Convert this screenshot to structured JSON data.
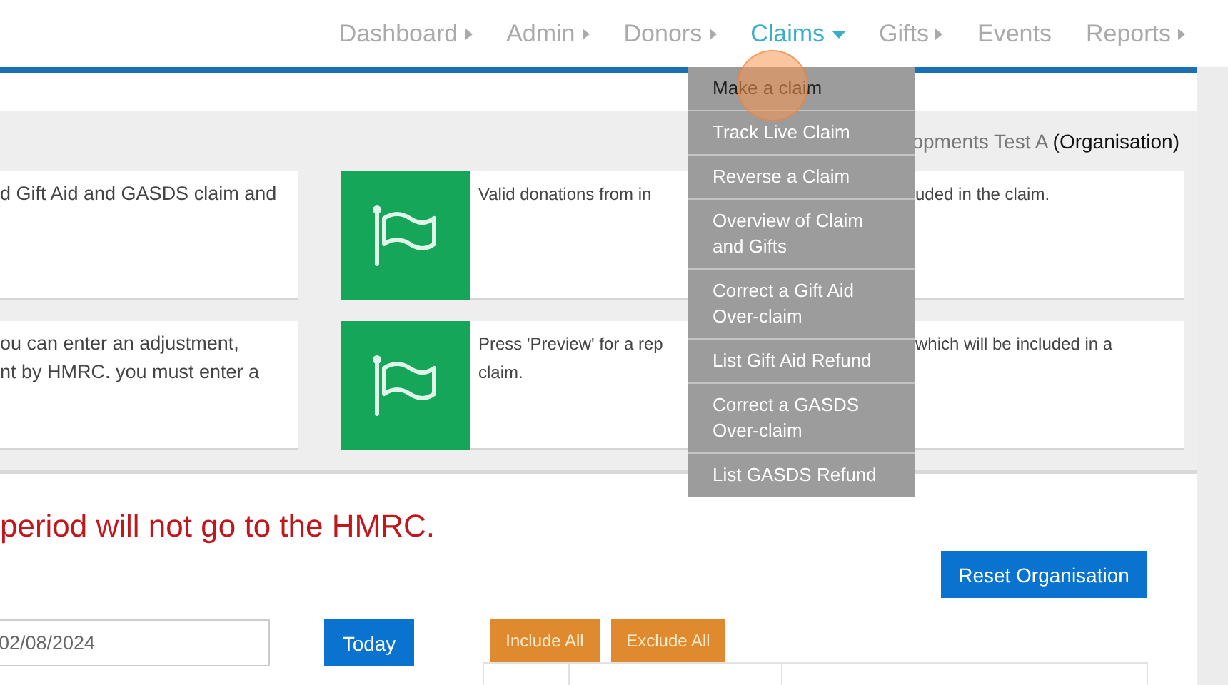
{
  "nav": {
    "items": [
      {
        "label": "Dashboard",
        "kind": "submenu",
        "selected": false
      },
      {
        "label": "Admin",
        "kind": "submenu",
        "selected": false
      },
      {
        "label": "Donors",
        "kind": "submenu",
        "selected": false
      },
      {
        "label": "Claims",
        "kind": "dropdown",
        "selected": true
      },
      {
        "label": "Gifts",
        "kind": "submenu",
        "selected": false
      },
      {
        "label": "Events",
        "kind": "plain",
        "selected": false
      },
      {
        "label": "Reports",
        "kind": "submenu",
        "selected": false
      }
    ]
  },
  "dropdown_menu": {
    "items": [
      {
        "label": "Make a claim",
        "highlighted": true
      },
      {
        "label": "Track Live Claim",
        "highlighted": false
      },
      {
        "label": "Reverse a Claim",
        "highlighted": false
      },
      {
        "label": "Overview of Claim\nand Gifts",
        "highlighted": false
      },
      {
        "label": "Correct a Gift Aid\nOver-claim",
        "highlighted": false
      },
      {
        "label": "List Gift Aid Refund",
        "highlighted": false
      },
      {
        "label": "Correct a GASDS\nOver-claim",
        "highlighted": false
      },
      {
        "label": "List GASDS Refund",
        "highlighted": false
      }
    ]
  },
  "organisation": "opments Test A **(Organisation)**",
  "cards": [
    {
      "left_text": "d Gift Aid and GASDS claim and",
      "right_text_start": "Valid donations from in",
      "right_text_end": "uded in the claim."
    },
    {
      "left_text": "ou can enter an adjustment,\nnt by HMRC. you must enter a",
      "right_text_start": "Press 'Preview' for a rep\nclaim.",
      "right_text_end": "which will be included in a"
    }
  ],
  "warning": "period will not go to the HMRC.",
  "reset_button": "Reset Organisation",
  "date_field": {
    "value": "02/08/2024"
  },
  "today_button": "Today",
  "include_all_button": "Include All",
  "exclude_all_button": "Exclude All"
}
